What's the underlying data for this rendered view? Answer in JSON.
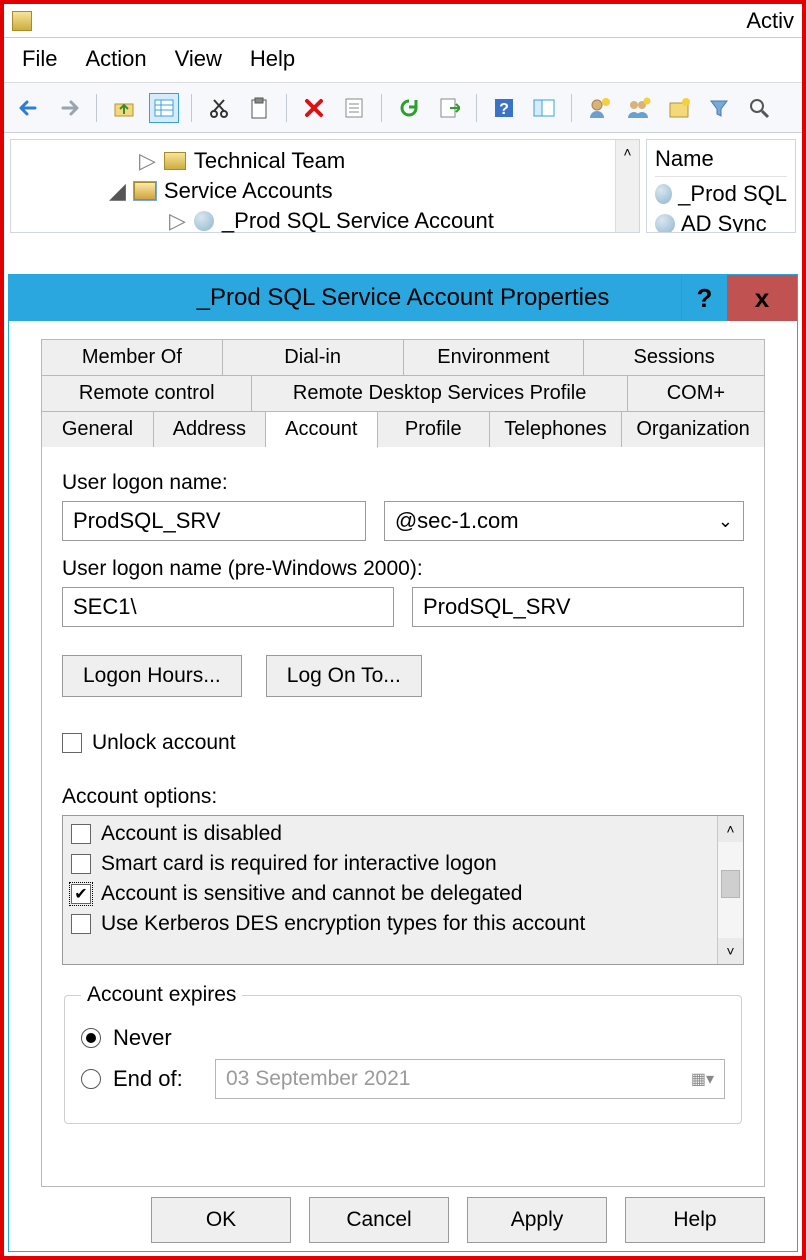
{
  "app": {
    "title_fragment": "Activ",
    "menus": [
      "File",
      "Action",
      "View",
      "Help"
    ]
  },
  "toolbar_icons": [
    "back-arrow-icon",
    "forward-arrow-icon",
    "|",
    "up-folder-icon",
    "table-grid-icon",
    "|",
    "cut-icon",
    "clipboard-icon",
    "|",
    "delete-x-icon",
    "properties-icon",
    "|",
    "refresh-icon",
    "export-list-icon",
    "|",
    "help-icon",
    "details-pane-icon",
    "|",
    "new-user-icon",
    "add-to-group-icon",
    "new-ou-icon",
    "filter-icon",
    "search-icon"
  ],
  "tree": {
    "row0": {
      "arrow": "▷",
      "label": "Technical Team"
    },
    "row1": {
      "arrow": "◀",
      "arrow_label": "◢?",
      "label": "Service Accounts",
      "expanded": true,
      "highlight": true
    },
    "row2": {
      "arrow": "▷",
      "label": "_Prod SQL Service Account"
    }
  },
  "list": {
    "header": "Name",
    "items": [
      "_Prod SQL",
      "AD Sync"
    ]
  },
  "dialog": {
    "title": "_Prod SQL Service Account Properties",
    "help_symbol": "?",
    "close_symbol": "x",
    "tabs": {
      "row1": [
        "Member Of",
        "Dial-in",
        "Environment",
        "Sessions"
      ],
      "row2": [
        "Remote control",
        "Remote Desktop Services Profile",
        "COM+"
      ],
      "row3": [
        "General",
        "Address",
        "Account",
        "Profile",
        "Telephones",
        "Organization"
      ],
      "active": "Account"
    },
    "account": {
      "logon_label": "User logon name:",
      "logon_value": "ProdSQL_SRV",
      "domain_value": "@sec-1.com",
      "pre2000_label": "User logon name (pre-Windows 2000):",
      "pre2000_domain": "SEC1\\",
      "pre2000_user": "ProdSQL_SRV",
      "btn_logon_hours": "Logon Hours...",
      "btn_log_on_to": "Log On To...",
      "unlock_label": "Unlock account",
      "unlock_checked": false,
      "options_label": "Account options:",
      "options": [
        {
          "label": "Account is disabled",
          "checked": false
        },
        {
          "label": "Smart card is required for interactive logon",
          "checked": false
        },
        {
          "label": "Account is sensitive and cannot be delegated",
          "checked": true,
          "focused": true
        },
        {
          "label": "Use Kerberos DES encryption types for this account",
          "checked": false
        }
      ],
      "expiry": {
        "legend": "Account expires",
        "never_label": "Never",
        "endof_label": "End of:",
        "selected": "never",
        "date_text": "03 September 2021"
      }
    },
    "buttons": {
      "ok": "OK",
      "cancel": "Cancel",
      "apply": "Apply",
      "help": "Help"
    }
  }
}
